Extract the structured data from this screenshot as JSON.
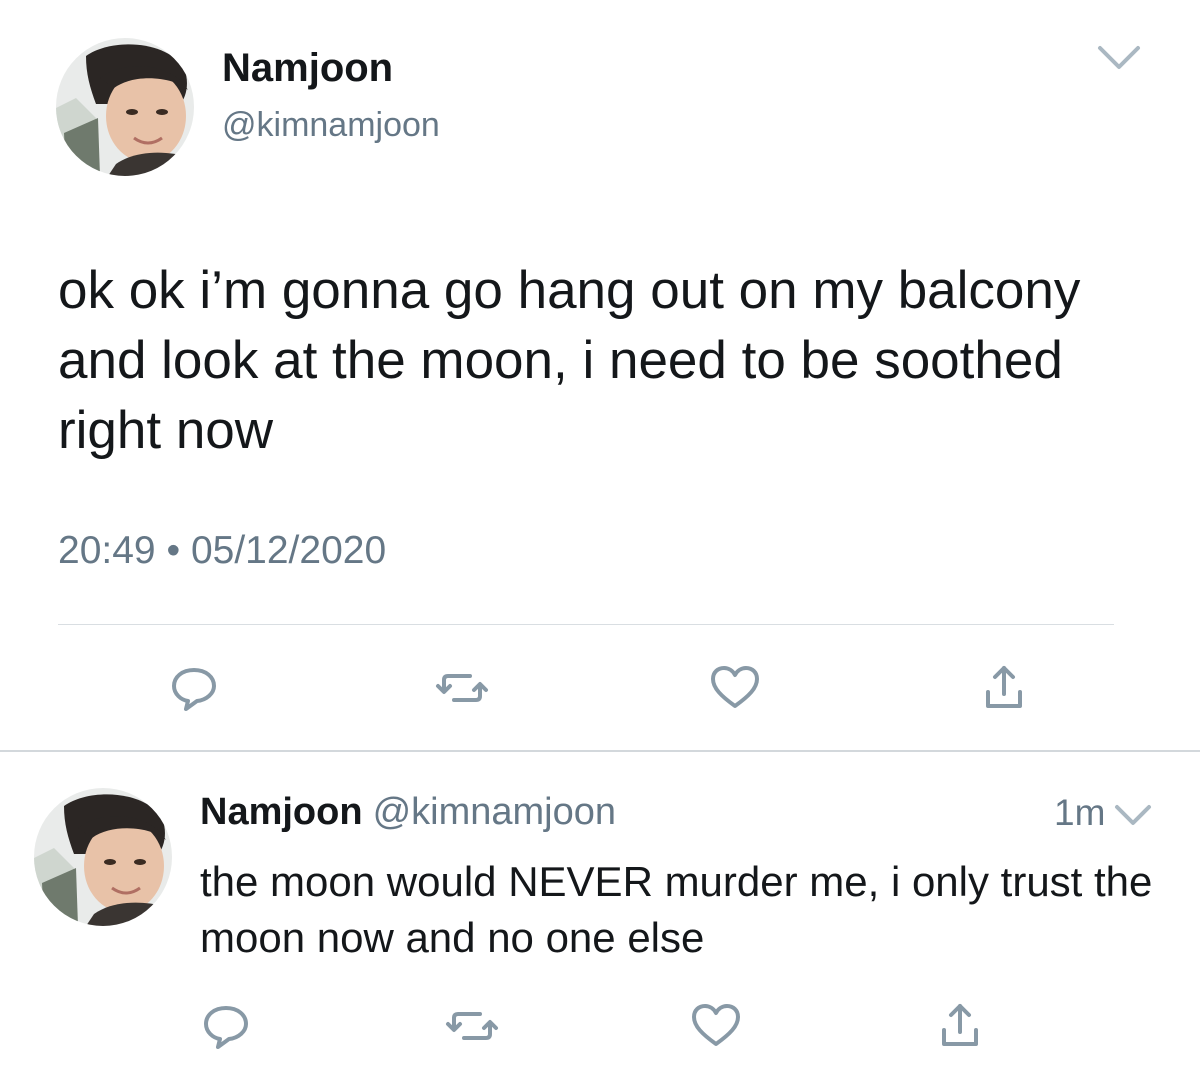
{
  "main_tweet": {
    "display_name": "Namjoon",
    "handle": "@kimnamjoon",
    "text": "ok ok i’m gonna go hang out on my balcony and look at the moon, i need to be soothed right now",
    "time": "20:49",
    "separator": "•",
    "date": "05/12/2020",
    "actions": [
      "reply-icon",
      "retweet-icon",
      "like-icon",
      "share-icon"
    ]
  },
  "reply_tweet": {
    "display_name": "Namjoon",
    "handle": "@kimnamjoon",
    "relative_time": "1m",
    "text": "the moon would NEVER murder me, i only trust the moon now and no one else",
    "actions": [
      "reply-icon",
      "retweet-icon",
      "like-icon",
      "share-icon"
    ]
  },
  "colors": {
    "text_primary": "#14171a",
    "text_secondary": "#657786",
    "icon_gray": "#8899a6",
    "divider": "#d9dee2"
  }
}
